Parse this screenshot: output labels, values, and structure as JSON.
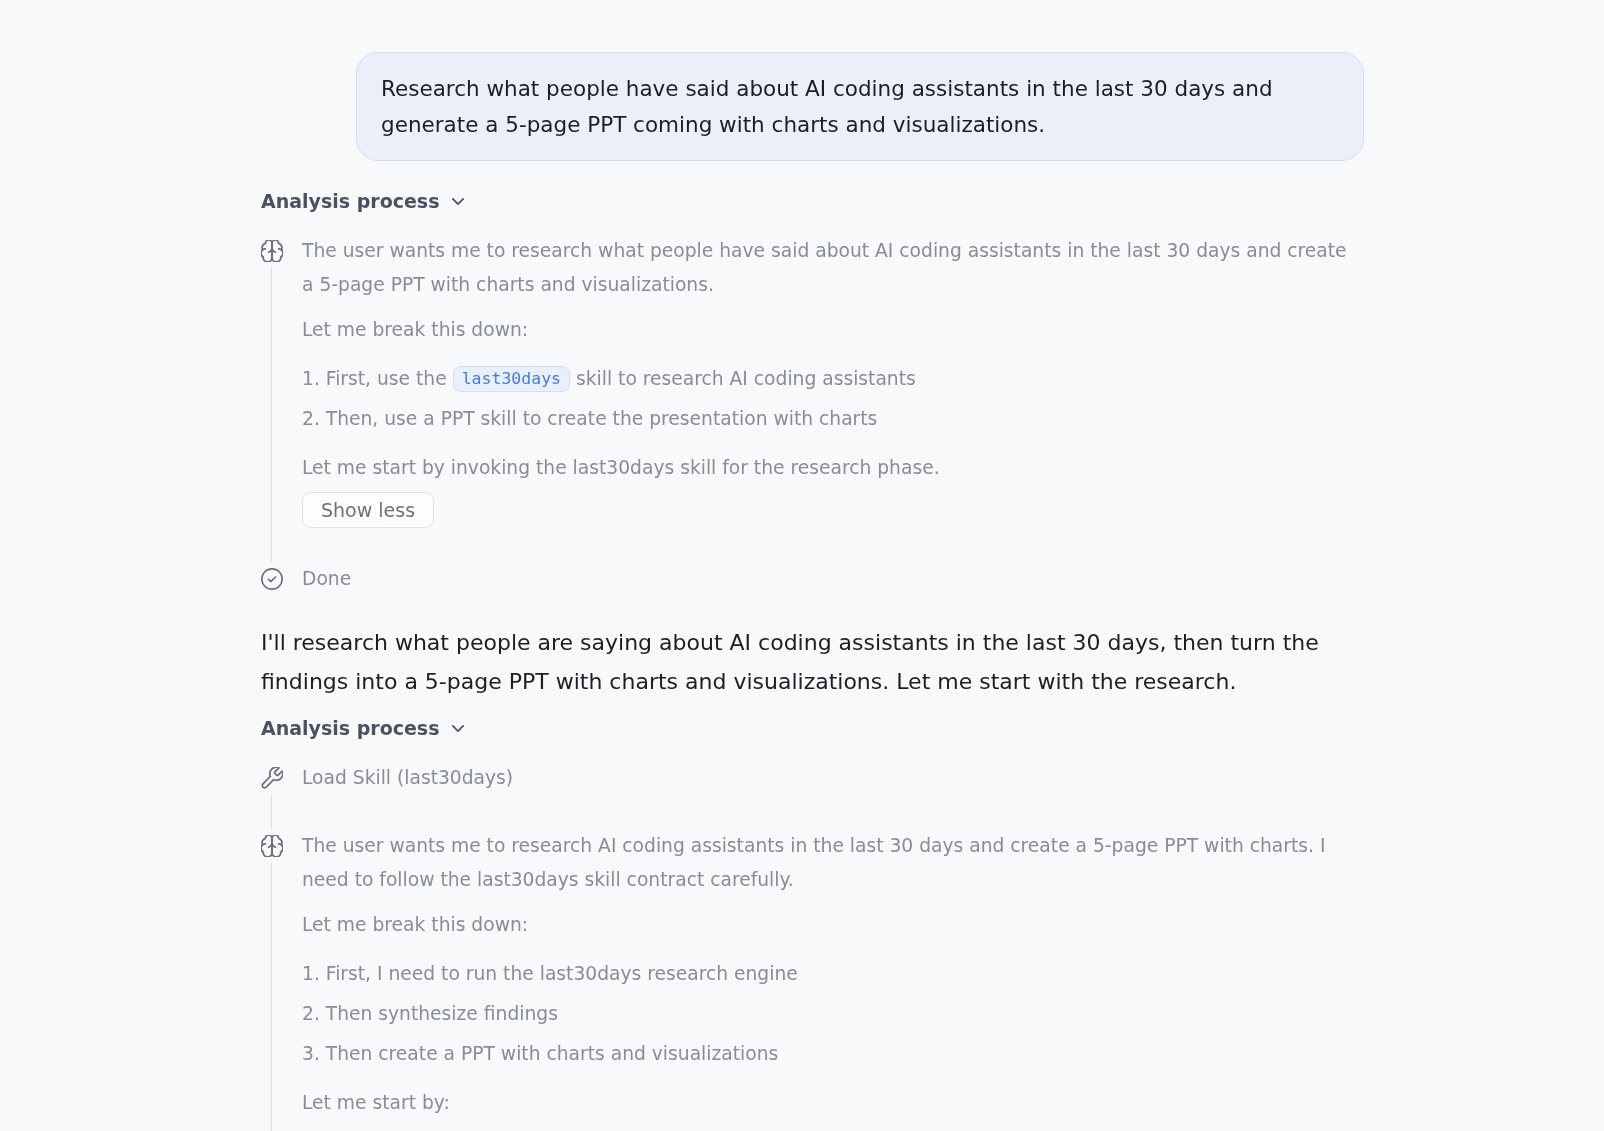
{
  "user_message": {
    "text": "Research what people have said about AI coding assistants in the last 30 days and generate a 5-page PPT coming with charts and visualizations."
  },
  "conversation": [
    {
      "kind": "process",
      "title": "Analysis process",
      "expanded": true,
      "steps": [
        {
          "kind": "thinking",
          "blocks": [
            {
              "kind": "paragraph",
              "text": "The user wants me to research what people have said about AI coding assistants in the last 30 days and create a 5-page PPT with charts and visualizations."
            },
            {
              "kind": "paragraph",
              "text": "Let me break this down:"
            },
            {
              "kind": "list",
              "items": [
                [
                  {
                    "kind": "text",
                    "text": "1. First, use the"
                  },
                  {
                    "kind": "code",
                    "text": "last30days"
                  },
                  {
                    "kind": "text",
                    "text": "skill to research AI coding assistants"
                  }
                ],
                [
                  {
                    "kind": "text",
                    "text": "2. Then, use a PPT skill to create the presentation with charts"
                  }
                ]
              ]
            },
            {
              "kind": "paragraph",
              "text": "Let me start by invoking the last30days skill for the research phase."
            }
          ],
          "toggle": "Show less"
        },
        {
          "kind": "done",
          "label": "Done"
        }
      ]
    },
    {
      "kind": "message",
      "text": "I'll research what people are saying about AI coding assistants in the last 30 days, then turn the findings into a 5-page PPT with charts and visualizations. Let me start with the research."
    },
    {
      "kind": "process",
      "title": "Analysis process",
      "expanded": true,
      "steps": [
        {
          "kind": "tool",
          "label": "Load Skill (last30days)"
        },
        {
          "kind": "thinking",
          "blocks": [
            {
              "kind": "paragraph",
              "text": "The user wants me to research AI coding assistants in the last 30 days and create a 5-page PPT with charts. I need to follow the last30days skill contract carefully."
            },
            {
              "kind": "paragraph",
              "text": "Let me break this down:"
            },
            {
              "kind": "list",
              "items": [
                [
                  {
                    "kind": "text",
                    "text": "1. First, I need to run the last30days research engine"
                  }
                ],
                [
                  {
                    "kind": "text",
                    "text": "2. Then synthesize findings"
                  }
                ],
                [
                  {
                    "kind": "text",
                    "text": "3. Then create a PPT with charts and visualizations"
                  }
                ]
              ]
            },
            {
              "kind": "paragraph",
              "text": "Let me start by:"
            }
          ]
        }
      ]
    }
  ]
}
